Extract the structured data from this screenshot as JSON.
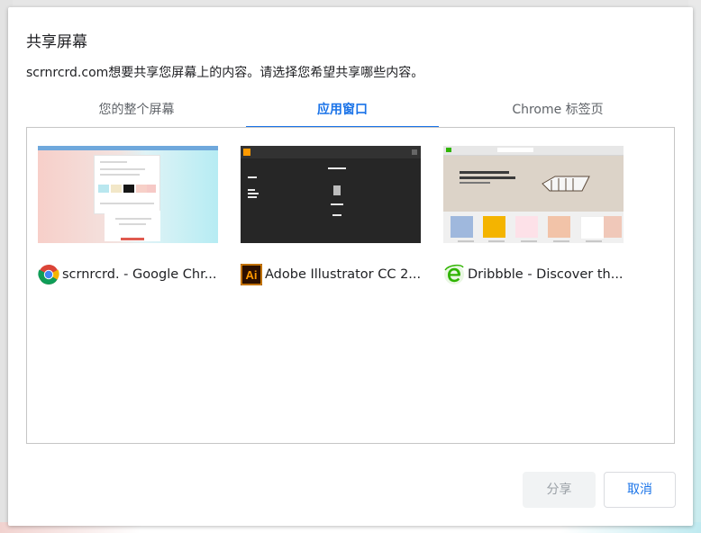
{
  "dialog": {
    "title": "共享屏幕",
    "subtitle": "scrnrcrd.com想要共享您屏幕上的内容。请选择您希望共享哪些内容。"
  },
  "tabs": [
    {
      "label": "您的整个屏幕",
      "selected": false
    },
    {
      "label": "应用窗口",
      "selected": true
    },
    {
      "label": "Chrome 标签页",
      "selected": false
    }
  ],
  "windows": [
    {
      "label": "scrnrcrd. - Google Chr...",
      "icon": "chrome-icon"
    },
    {
      "label": "Adobe Illustrator CC 2...",
      "icon": "illustrator-icon"
    },
    {
      "label": "Dribbble - Discover th...",
      "icon": "ie-icon"
    }
  ],
  "illustrator_icon_text": "Ai",
  "buttons": {
    "share": "分享",
    "cancel": "取消"
  },
  "colors": {
    "accent": "#1a73e8",
    "illustrator": "#ff9a00",
    "ie": "#2fb400"
  }
}
